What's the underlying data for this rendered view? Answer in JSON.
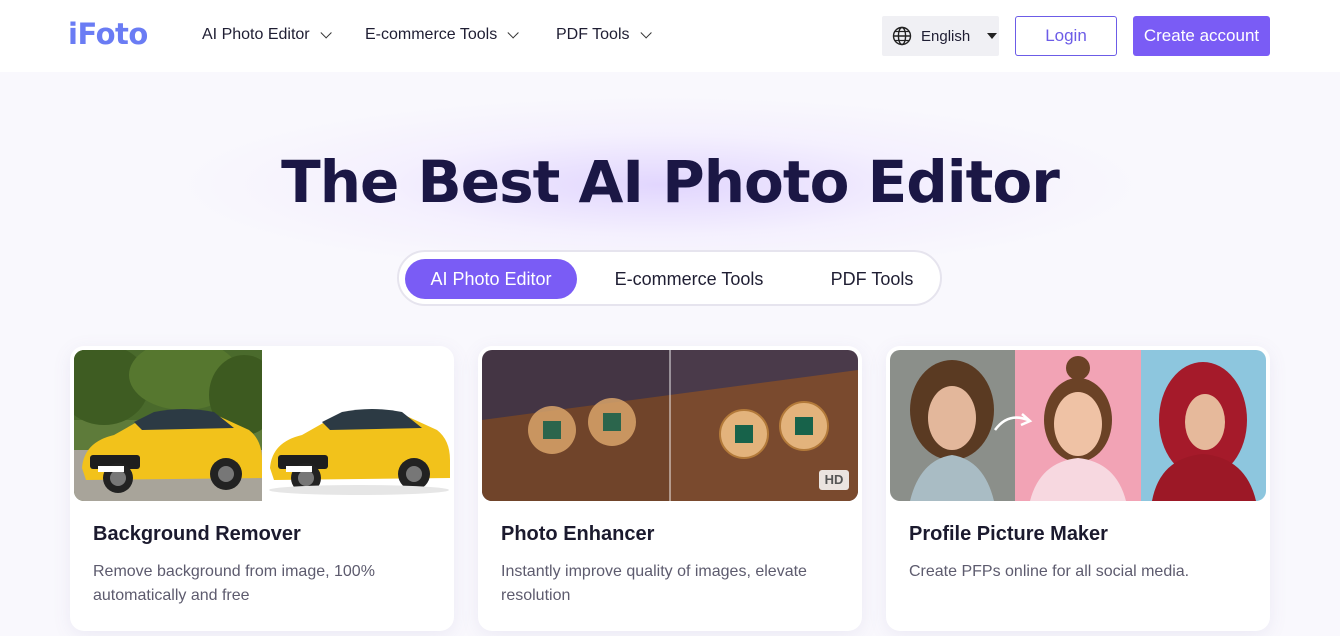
{
  "header": {
    "logo": "iFoto",
    "nav": [
      {
        "label": "AI Photo Editor"
      },
      {
        "label": "E-commerce Tools"
      },
      {
        "label": "PDF Tools"
      }
    ],
    "language": "English",
    "login_label": "Login",
    "create_label": "Create account"
  },
  "hero": {
    "title": "The Best AI Photo Editor",
    "tabs": [
      {
        "label": "AI Photo Editor",
        "active": true
      },
      {
        "label": "E-commerce Tools",
        "active": false
      },
      {
        "label": "PDF Tools",
        "active": false
      }
    ]
  },
  "cards": [
    {
      "title": "Background Remover",
      "description": "Remove background from image, 100% automatically and free"
    },
    {
      "title": "Photo Enhancer",
      "description": "Instantly improve quality of images, elevate resolution",
      "badge": "HD"
    },
    {
      "title": "Profile Picture Maker",
      "description": "Create PFPs online for all social media."
    }
  ],
  "colors": {
    "accent": "#7a5cf5",
    "title": "#1b1745",
    "logo": "#6a7cf4"
  }
}
